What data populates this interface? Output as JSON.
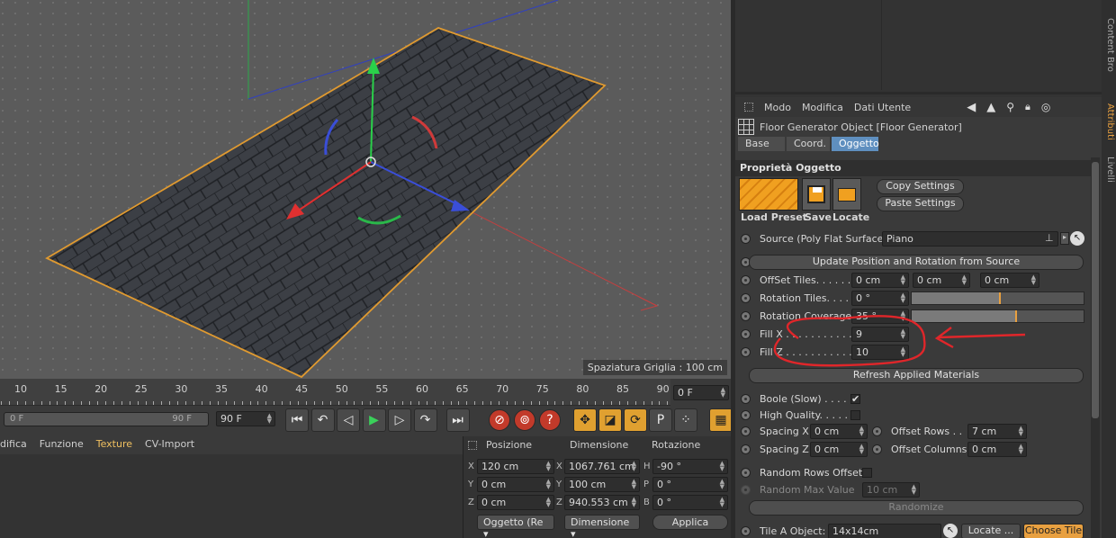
{
  "viewport": {
    "grid_label": "Spaziatura Griglia : 100 cm"
  },
  "timeline": {
    "ruler_ticks": [
      "10",
      "15",
      "20",
      "25",
      "30",
      "35",
      "40",
      "45",
      "50",
      "55",
      "60",
      "65",
      "70",
      "75",
      "80",
      "85",
      "90"
    ],
    "current_frame": "0 F",
    "range_start": "0 F",
    "range_end": "90 F",
    "end_field": "90 F"
  },
  "transport": {
    "buttons": [
      {
        "name": "goto-start-button",
        "glyph": "⏮"
      },
      {
        "name": "prev-key-button",
        "glyph": "↶"
      },
      {
        "name": "prev-frame-button",
        "glyph": "◁"
      },
      {
        "name": "play-button",
        "glyph": "▶"
      },
      {
        "name": "next-frame-button",
        "glyph": "▷"
      },
      {
        "name": "next-key-button",
        "glyph": "↷"
      },
      {
        "name": "goto-end-button",
        "glyph": "⏭"
      }
    ],
    "record": [
      {
        "name": "record-key-button",
        "glyph": "⊘"
      },
      {
        "name": "autokey-button",
        "glyph": "⊚"
      },
      {
        "name": "keyframe-help-button",
        "glyph": "?"
      }
    ],
    "tools": [
      {
        "name": "move-tool-icon",
        "glyph": "✥"
      },
      {
        "name": "scale-tool-icon",
        "glyph": "◪"
      },
      {
        "name": "rotate-tool-icon",
        "glyph": "⟳"
      },
      {
        "name": "param-tool-icon",
        "glyph": "P"
      },
      {
        "name": "pla-tool-icon",
        "glyph": "⁘"
      }
    ],
    "film_icon": "▦"
  },
  "material_manager": {
    "menu": [
      "difica",
      "Funzione",
      "Texture",
      "CV-Import"
    ],
    "active": "Texture"
  },
  "coordinates": {
    "headers": [
      "Posizione",
      "Dimensione",
      "Rotazione"
    ],
    "rows": [
      {
        "axis": "X",
        "pos": "120 cm",
        "dim_axis": "X",
        "dim": "1067.761 cm",
        "rot_axis": "H",
        "rot": "-90 °"
      },
      {
        "axis": "Y",
        "pos": "0 cm",
        "dim_axis": "Y",
        "dim": "100 cm",
        "rot_axis": "P",
        "rot": "0 °"
      },
      {
        "axis": "Z",
        "pos": "0 cm",
        "dim_axis": "Z",
        "dim": "940.553 cm",
        "rot_axis": "B",
        "rot": "0 °"
      }
    ],
    "mode_select": "Oggetto (Re",
    "size_select": "Dimensione",
    "apply": "Applica"
  },
  "attributes": {
    "menu": [
      "Modo",
      "Modifica",
      "Dati Utente"
    ],
    "object_title": "Floor Generator Object [Floor Generator]",
    "tabs": [
      "Base",
      "Coord.",
      "Oggetto"
    ],
    "selected_tab": "Oggetto",
    "section": "Proprietà Oggetto",
    "preset": {
      "load": "Load Preset",
      "save": "Save",
      "locate": "Locate",
      "copy": "Copy Settings",
      "paste": "Paste Settings"
    },
    "source_label": "Source (Poly Flat Surface):",
    "source_value": "Piano",
    "update_button": "Update Position and Rotation from Source",
    "offset_tiles": {
      "label": "OffSet Tiles. . . . . .",
      "x": "0 cm",
      "y": "0 cm",
      "z": "0 cm"
    },
    "rotation_tiles": {
      "label": "Rotation Tiles. . . .",
      "value": "0 °",
      "slider": 0.0
    },
    "rotation_coverage": {
      "label": "Rotation Coverage",
      "value": "35 °",
      "slider": 0.35
    },
    "fill_x": {
      "label": "Fill X . . . . . . . . . . .",
      "value": "9"
    },
    "fill_z": {
      "label": "Fill Z . . . . . . . . . . .",
      "value": "10"
    },
    "refresh_button": "Refresh Applied Materials",
    "boole": {
      "label": "Boole (Slow) . . . . .",
      "checked": true
    },
    "high_quality": {
      "label": "High Quality. . . . .",
      "checked": false
    },
    "spacing_x": {
      "label": "Spacing X",
      "value": "0 cm"
    },
    "spacing_z": {
      "label": "Spacing Z",
      "value": "0 cm"
    },
    "offset_rows": {
      "label": "Offset Rows . .",
      "value": "7 cm"
    },
    "offset_columns": {
      "label": "Offset Columns",
      "value": "0 cm"
    },
    "random_rows": {
      "label": "Random Rows Offset",
      "checked": false
    },
    "random_max": {
      "label": "Random Max Value",
      "value": "10 cm"
    },
    "randomize_button": "Randomize",
    "tile_a": {
      "label": "Tile A Object:",
      "value": "14x14cm",
      "locate": "Locate ...",
      "choose": "Choose Tile"
    }
  },
  "side_tabs": [
    "Content Bro",
    "Attributi",
    "Livelli"
  ],
  "colors": {
    "accent": "#e8a040",
    "selected_tab": "#5f8fbf",
    "annotation": "#e0262a"
  }
}
